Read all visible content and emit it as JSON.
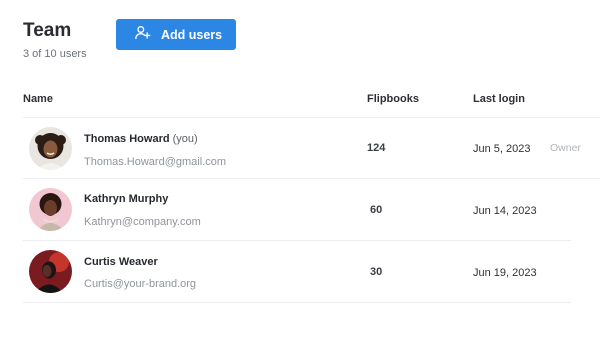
{
  "header": {
    "title": "Team",
    "subtitle": "3 of 10 users",
    "add_button_label": "Add users",
    "add_button_icon": "add-user-icon",
    "accent_color": "#2b86e4"
  },
  "table": {
    "columns": [
      "Name",
      "Flipbooks",
      "Last login"
    ],
    "rows": [
      {
        "name": "Thomas Howard",
        "you_tag": "(you)",
        "email": "Thomas.Howard@gmail.com",
        "flipbooks": "124",
        "last_login": "Jun 5, 2023",
        "role": "Owner"
      },
      {
        "name": "Kathryn Murphy",
        "email": "Kathryn@company.com",
        "flipbooks": "60",
        "last_login": "Jun 14, 2023"
      },
      {
        "name": "Curtis Weaver",
        "email": "Curtis@your-brand.org",
        "flipbooks": "30",
        "last_login": "Jun 19, 2023"
      }
    ]
  }
}
